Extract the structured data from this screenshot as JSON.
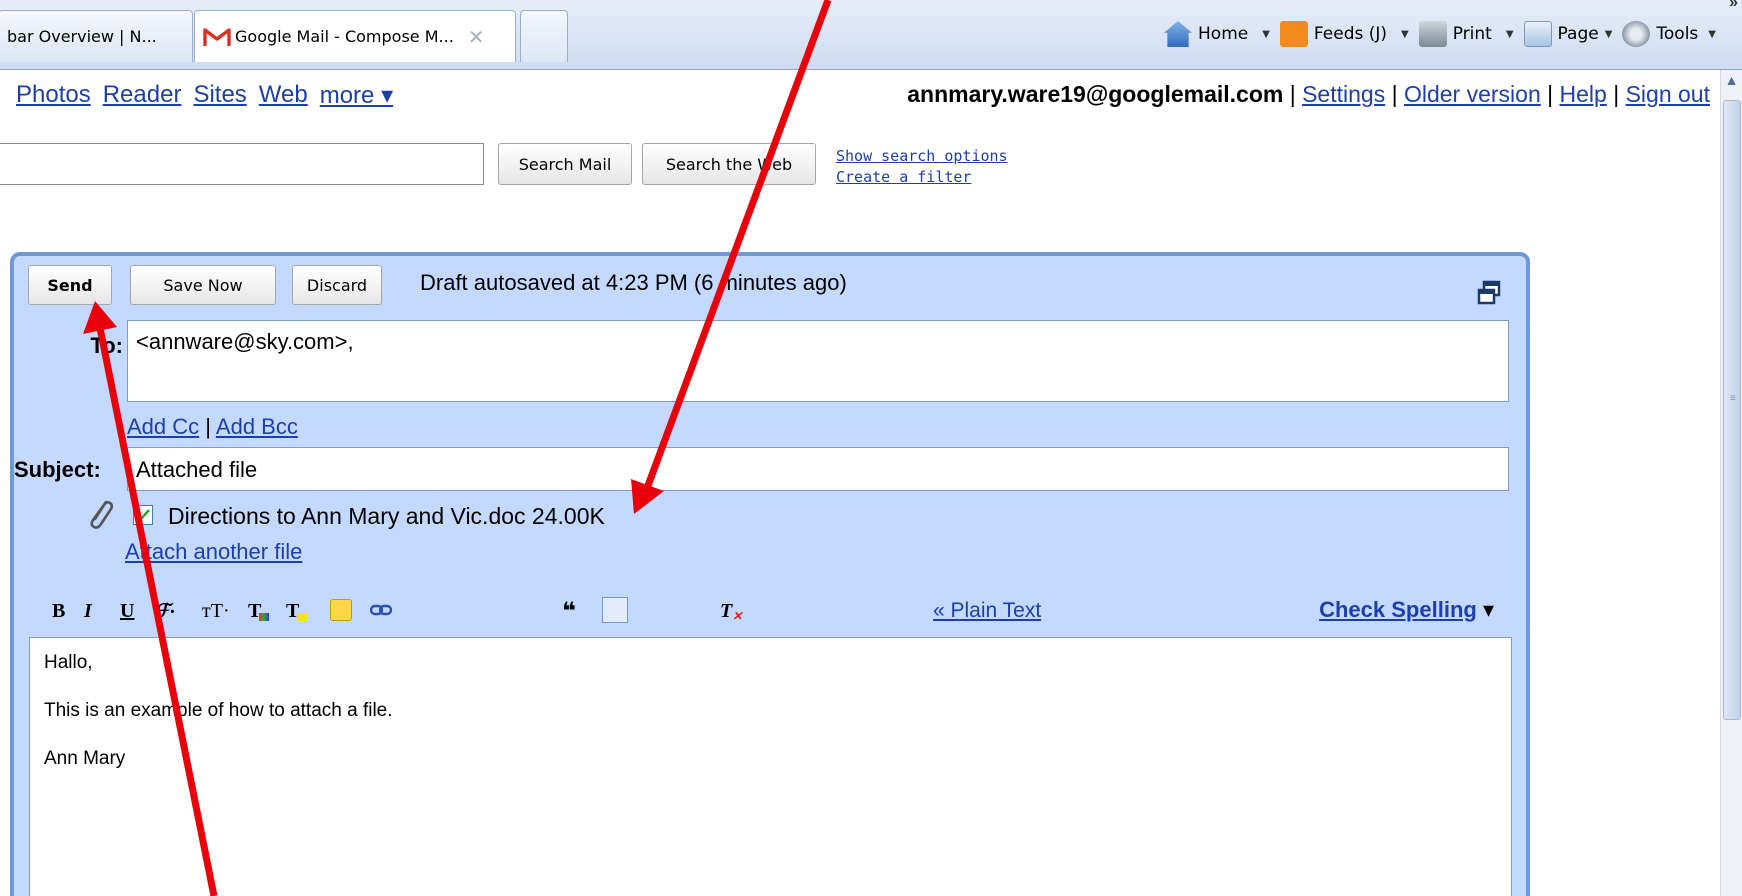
{
  "browser": {
    "tabs": [
      {
        "label": "bar Overview | N..."
      },
      {
        "label": "Google Mail - Compose M..."
      },
      {
        "label": ""
      }
    ],
    "commands": {
      "home": "Home",
      "feeds": "Feeds (J)",
      "print": "Print",
      "page": "Page",
      "tools": "Tools",
      "more": "»"
    }
  },
  "topnav": {
    "links": [
      "Photos",
      "Reader",
      "Sites",
      "Web",
      "more ▾"
    ],
    "account_email": "annmary.ware19@googlemail.com",
    "account_links": [
      "Settings",
      "Older version",
      "Help",
      "Sign out"
    ],
    "separator": "|"
  },
  "search": {
    "query": "",
    "search_mail": "Search Mail",
    "search_web": "Search the Web",
    "show_options": "Show search options",
    "create_filter": "Create a filter"
  },
  "compose": {
    "send": "Send",
    "save_now": "Save Now",
    "discard": "Discard",
    "draft_status": "Draft autosaved at 4:23 PM (6 minutes ago)",
    "to_label": "To:",
    "to_value": "<annware@sky.com>,",
    "add_cc": "Add Cc",
    "cc_sep": "|",
    "add_bcc": "Add Bcc",
    "subject_label": "Subject:",
    "subject_value": "Attached file",
    "attachment": "Directions to Ann Mary and Vic.doc 24.00K",
    "attach_another": "Attach another file",
    "plain_text": "« Plain Text",
    "check_spelling": "Check Spelling",
    "check_spelling_arrow": "▾",
    "body_lines": [
      "Hallo,",
      "This is an example of how to attach a file.",
      "Ann Mary"
    ]
  },
  "colors": {
    "compose_bg": "#c3d9ff",
    "compose_border": "#6f97d9",
    "link": "#1c3faa",
    "annotation": "#e8000b"
  }
}
